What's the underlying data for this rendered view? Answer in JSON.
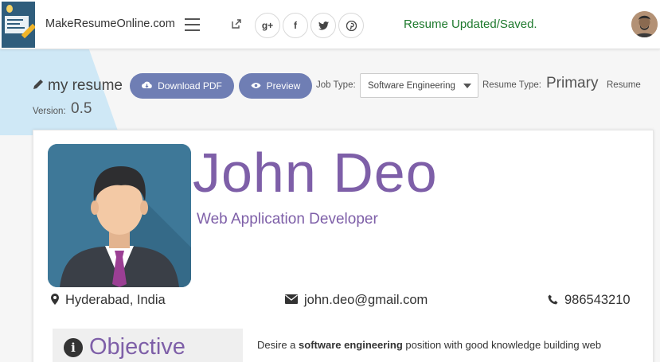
{
  "header": {
    "brand": "MakeResumeOnline.com",
    "status": "Resume Updated/Saved.",
    "social": [
      {
        "icon": "google-plus-icon",
        "glyph": "g+"
      },
      {
        "icon": "facebook-icon",
        "glyph": "f"
      },
      {
        "icon": "twitter-icon",
        "glyph": "t"
      },
      {
        "icon": "pinterest-icon",
        "glyph": "p"
      }
    ]
  },
  "toolbar": {
    "title": "my resume",
    "download_label": "Download PDF",
    "preview_label": "Preview",
    "job_type_label": "Job Type:",
    "job_type_value": "Software Engineering",
    "resume_type_label": "Resume Type:",
    "resume_type_value": "Primary",
    "resume_version_label": "Resume",
    "version_label": "Version:",
    "version_value": "0.5"
  },
  "resume": {
    "name": "John Deo",
    "role": "Web Application Developer",
    "location": "Hyderabad, India",
    "email": "john.deo@gmail.com",
    "phone": "986543210",
    "objective_title": "Objective",
    "objective_text_prefix": "Desire a ",
    "objective_text_bold": "software engineering",
    "objective_text_suffix": " position with good knowledge building web"
  },
  "colors": {
    "accent": "#7e5fa8",
    "button": "#6f7eb4",
    "status": "#1f7a2e"
  }
}
